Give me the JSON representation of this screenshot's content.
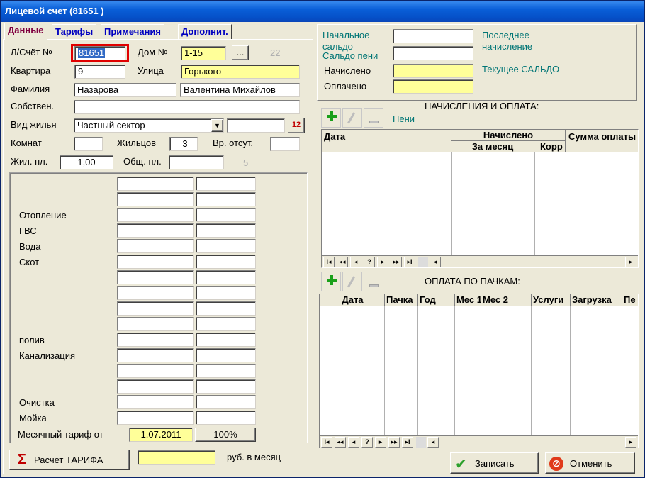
{
  "window": {
    "title": "Лицевой счет  (81651  )"
  },
  "tabs": [
    {
      "label": "Данные"
    },
    {
      "label": "Тарифы"
    },
    {
      "label": "Примечания"
    },
    {
      "label": "Дополнит."
    }
  ],
  "form": {
    "account_label": "Л/Счёт №",
    "account_value": "81651",
    "house_label": "Дом №",
    "house_value": "1-15",
    "browse_label": "...",
    "house_code": "22",
    "apartment_label": "Квартира",
    "apartment_value": "9",
    "street_label": "Улица",
    "street_value": "Горького",
    "surname_label": "Фамилия",
    "surname_value": "Назарова",
    "name_value": "Валентина Михайлов",
    "owner_label": "Собствен.",
    "owner_value": "",
    "housing_type_label": "Вид жилья",
    "housing_type_value": "Частный сектор",
    "calendar_label": "12",
    "rooms_label": "Комнат",
    "rooms_value": "",
    "residents_label": "Жильцов",
    "residents_value": "3",
    "temp_absent_label": "Вр. отсут.",
    "temp_absent_value": "",
    "living_area_label": "Жил. пл.",
    "living_area_value": "1,00",
    "total_area_label": "Общ. пл.",
    "total_area_value": "",
    "area_code": "5"
  },
  "services": {
    "labels": [
      "Отопление",
      "ГВС",
      "Вода",
      "Скот",
      "полив",
      "Канализация",
      "Очистка",
      "Мойка"
    ],
    "tariff_label": "Месячный тариф  от",
    "tariff_date": "1.07.2011",
    "tariff_percent": "100%"
  },
  "bottom_left": {
    "calc_button": "Расчет ТАРИФА",
    "calc_value": "",
    "unit_label": "руб. в месяц"
  },
  "summary": {
    "opening_balance_label": "Начальное сальдо",
    "penalty_balance_label": "Сальдо пени",
    "charged_label": "Начислено",
    "paid_label": "Оплачено",
    "last_charge_label": "Последнее начисление",
    "current_balance_label": "Текущее САЛЬДО"
  },
  "charges": {
    "title": "НАЧИСЛЕНИЯ И ОПЛАТА:",
    "penalty_label": "Пени",
    "col_date": "Дата",
    "col_charged": "Начислено",
    "col_month": "За месяц",
    "col_corr": "Корр",
    "col_payment": "Сумма оплаты"
  },
  "payments": {
    "title": "ОПЛАТА ПО ПАЧКАМ:",
    "columns": [
      "Дата",
      "Пачка",
      "Год",
      "Мес 1",
      "Мес 2",
      "Услуги",
      "Загрузка",
      "Пе"
    ]
  },
  "nav": {
    "first": "I◂",
    "prev_page": "◂◂",
    "prev": "◂",
    "help": "?",
    "next": "▸",
    "next_page": "▸▸",
    "last": "▸I"
  },
  "actions": {
    "save": "Записать",
    "cancel": "Отменить"
  }
}
